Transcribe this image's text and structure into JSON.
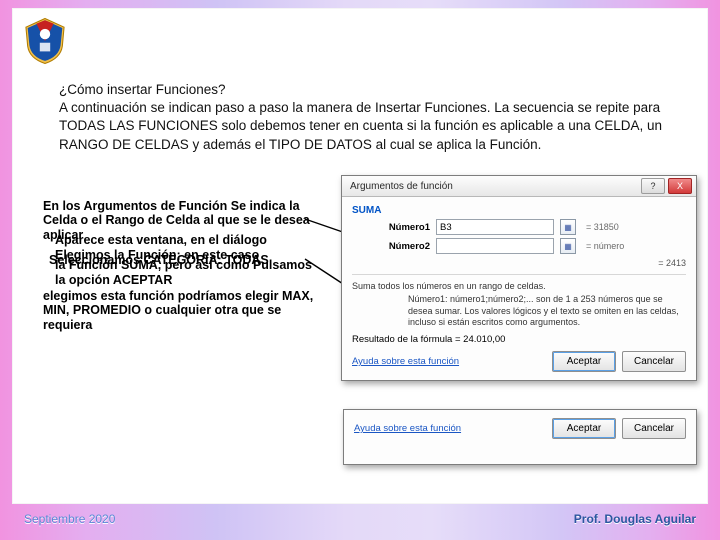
{
  "heading": {
    "q": "¿Cómo insertar Funciones?",
    "body": "A continuación se indican paso a paso la manera de Insertar Funciones. La secuencia se repite para TODAS LAS FUNCIONES solo debemos tener en cuenta si la función es aplicable a una CELDA, un RANGO DE CELDAS y además el TIPO DE DATOS al cual se aplica la Función."
  },
  "overlay": {
    "p1": "En los Argumentos de Función Se indica la Celda o el Rango de Celda al que se le desea aplicar",
    "p2": "Aparece esta ventana, en el diálogo Elegimos la Función; en este caso",
    "p3": "Seleccionamos CATEGORIA: TODAS",
    "p4": "la Función SUMA, pero así como Pulsamos la opción ACEPTAR",
    "p5": "elegimos esta función podríamos elegir MAX, MIN, PROMEDIO o cualquier otra que se requiera"
  },
  "dialog": {
    "title": "Argumentos de función",
    "fn": "SUMA",
    "arg1_label": "Número1",
    "arg1_value": "B3",
    "arg1_hint": "= 31850",
    "arg2_label": "Número2",
    "arg2_value": "",
    "arg2_hint": "= número",
    "right_result": "= 2413",
    "desc1": "Suma todos los números en un rango de celdas.",
    "desc2": "Número1: número1;número2;... son de 1 a 253 números que se desea sumar. Los valores lógicos y el texto se omiten en las celdas, incluso si están escritos como argumentos.",
    "result_label": "Resultado de la fórmula =",
    "result_value": "24.010,00",
    "help": "Ayuda sobre esta función",
    "accept": "Aceptar",
    "cancel": "Cancelar"
  },
  "footer": {
    "left": "Septiembre 2020",
    "right": "Prof. Douglas Aguilar"
  },
  "icons": {
    "help_q": "?",
    "close_x": "X",
    "ref": "▦"
  }
}
